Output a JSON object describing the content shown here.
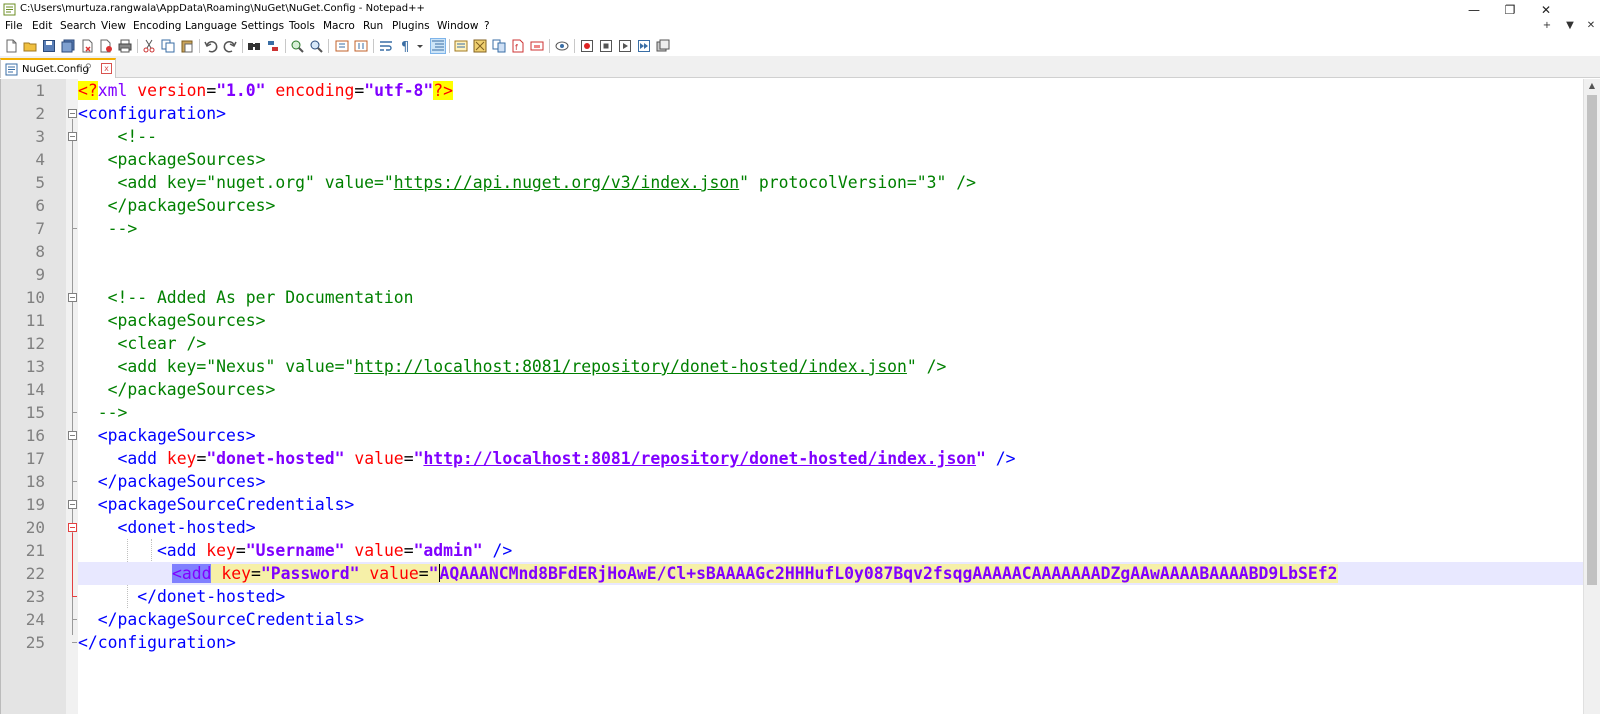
{
  "window": {
    "title": "C:\\Users\\murtuza.rangwala\\AppData\\Roaming\\NuGet\\NuGet.Config - Notepad++",
    "minimize": "—",
    "restore": "❐",
    "close": "✕"
  },
  "menu": {
    "items": [
      "File",
      "Edit",
      "Search",
      "View",
      "Encoding",
      "Language",
      "Settings",
      "Tools",
      "Macro",
      "Run",
      "Plugins",
      "Window",
      "?"
    ],
    "right": [
      "+",
      "▼",
      "✕"
    ]
  },
  "tab": {
    "label": "NuGet.Config",
    "pin": "⚲",
    "close": "x"
  },
  "editor": {
    "line_numbers": [
      "1",
      "2",
      "3",
      "4",
      "5",
      "6",
      "7",
      "8",
      "9",
      "10",
      "11",
      "12",
      "13",
      "14",
      "15",
      "16",
      "17",
      "18",
      "19",
      "20",
      "21",
      "22",
      "23",
      "24",
      "25"
    ],
    "lines": {
      "l1": {
        "a": "<?",
        "b": "xml",
        "c": " version",
        "d": "=",
        "e": "\"1.0\"",
        "f": " encoding",
        "g": "=",
        "h": "\"utf-8\"",
        "i": "?>"
      },
      "l2": {
        "a": "<configuration>"
      },
      "l3": {
        "a": "    <!--"
      },
      "l4": {
        "a": "   <packageSources>"
      },
      "l5": {
        "a": "    <add key=\"nuget.org\" value=\"",
        "b": "https://api.nuget.org/v3/index.json",
        "c": "\" protocolVersion=\"3\" />"
      },
      "l6": {
        "a": "   </packageSources>"
      },
      "l7": {
        "a": "   -->"
      },
      "l10": {
        "a": "   <!-- Added As per Documentation"
      },
      "l11": {
        "a": "   <packageSources>"
      },
      "l12": {
        "a": "    <clear />"
      },
      "l13": {
        "a": "    <add key=\"Nexus\" value=\"",
        "b": "http://localhost:8081/repository/donet-hosted/index.json",
        "c": "\" />"
      },
      "l14": {
        "a": "   </packageSources>"
      },
      "l15": {
        "a": "  -->"
      },
      "l16": {
        "a": "  <packageSources>"
      },
      "l17": {
        "a": "    <add",
        "b": " key",
        "c": "=",
        "d": "\"donet-hosted\"",
        "e": " value",
        "f": "=",
        "g": "\"",
        "h": "http://localhost:8081/repository/donet-hosted/index.json",
        "i": "\"",
        "j": " />"
      },
      "l18": {
        "a": "  </packageSources>"
      },
      "l19": {
        "a": "  <packageSourceCredentials>"
      },
      "l20": {
        "a": "    <donet-hosted>"
      },
      "l21": {
        "a": "        <add",
        "b": " key",
        "c": "=",
        "d": "\"Username\"",
        "e": " value",
        "f": "=",
        "g": "\"admin\"",
        "h": " />"
      },
      "l22": {
        "a": "<add",
        "b": "key",
        "c": "=",
        "d": "\"Password\"",
        "e": "value",
        "f": "=",
        "g": "\"",
        "h": "AQAAANCMnd8BFdERjHoAwE/Cl+sBAAAAGc2HHHufL0y087Bqv2fsqgAAAAACAAAAAAADZgAAwAAAABAAAABD9LbSEf2"
      },
      "l23": {
        "a": "      </donet-hosted>"
      },
      "l24": {
        "a": "  </packageSourceCredentials>"
      },
      "l25": {
        "a": "</configuration>"
      }
    }
  },
  "colors": {
    "tag": "#0000ff",
    "attribute": "#ff0000",
    "value": "#8000ff",
    "comment": "#008000",
    "current_line": "#e8e8ff",
    "tab_accent": "#f4b000"
  }
}
